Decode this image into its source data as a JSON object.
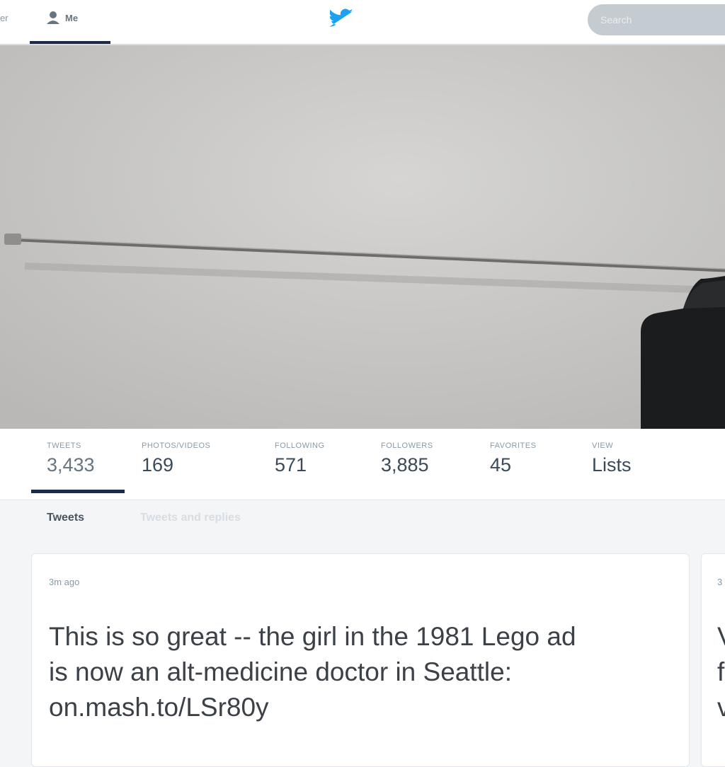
{
  "nav": {
    "partial_label": "er",
    "me_label": "Me",
    "search_placeholder": "Search"
  },
  "stats": [
    {
      "label": "TWEETS",
      "value": "3,433"
    },
    {
      "label": "PHOTOS/VIDEOS",
      "value": "169"
    },
    {
      "label": "FOLLOWING",
      "value": "571"
    },
    {
      "label": "FOLLOWERS",
      "value": "3,885"
    },
    {
      "label": "FAVORITES",
      "value": "45"
    },
    {
      "label": "VIEW",
      "value": "Lists"
    }
  ],
  "tabs": {
    "tweets": "Tweets",
    "tweets_replies": "Tweets and replies"
  },
  "tweet": {
    "time": "3m ago",
    "text_line1": "This is so great -- the girl in the 1981 Lego ad",
    "text_line2": "is now an alt-medicine doctor in Seattle:",
    "link": "on.mash.to/LSr80y"
  },
  "tweet2": {
    "time": "3",
    "line1": "V",
    "line2": "f",
    "line3": "v"
  },
  "colors": {
    "accent": "#1da1f2",
    "nav_active": "#1c2a4a"
  }
}
